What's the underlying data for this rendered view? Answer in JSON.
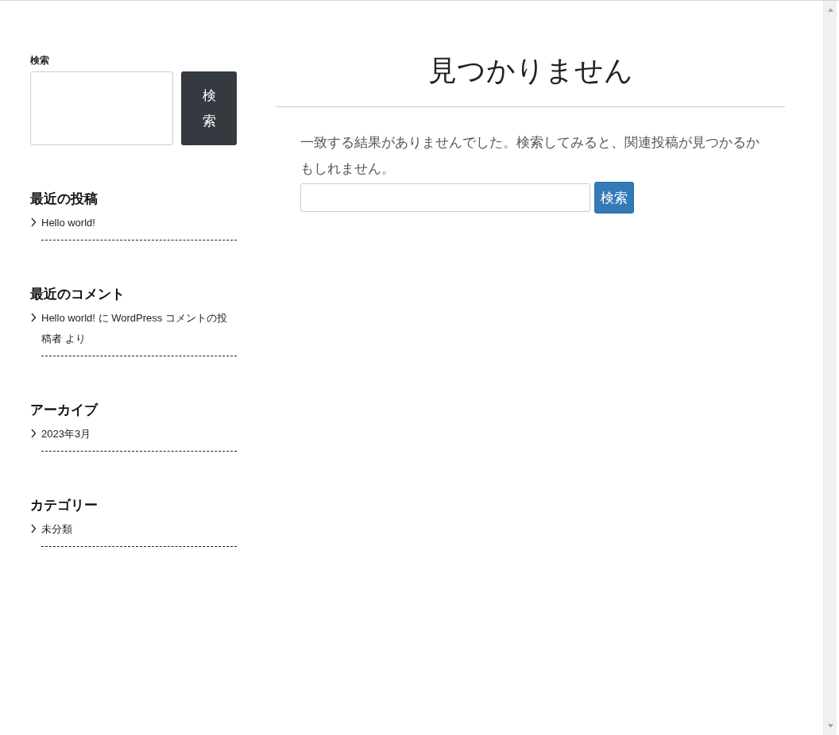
{
  "sidebar": {
    "search": {
      "label": "検索",
      "button": "検索"
    },
    "widgets": [
      {
        "title": "最近の投稿",
        "items": [
          "Hello world!"
        ]
      },
      {
        "title": "最近のコメント",
        "items": [
          "Hello world! に WordPress コメントの投稿者 より"
        ]
      },
      {
        "title": "アーカイブ",
        "items": [
          "2023年3月"
        ]
      },
      {
        "title": "カテゴリー",
        "items": [
          "未分類"
        ]
      }
    ]
  },
  "main": {
    "title": "見つかりません",
    "message": "一致する結果がありませんでした。検索してみると、関連投稿が見つかるかもしれません。",
    "search": {
      "button": "検索"
    }
  }
}
